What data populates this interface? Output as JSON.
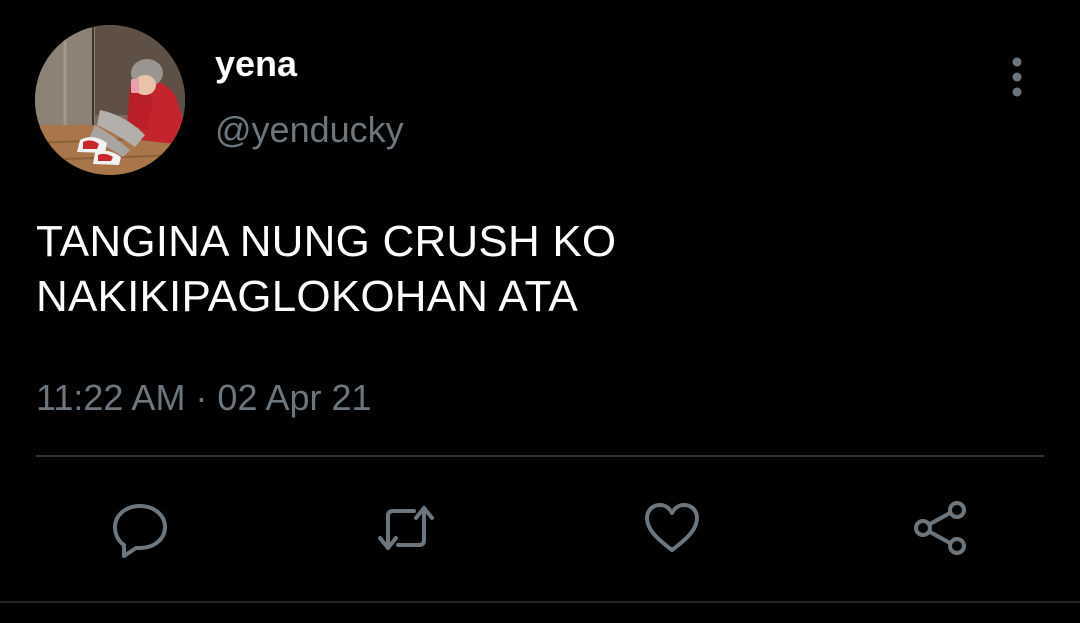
{
  "tweet": {
    "display_name": "yena",
    "handle": "@yenducky",
    "text_lines": [
      "TANGINA NUNG CRUSH KO",
      "NAKIKIPAGLOKOHAN ATA"
    ],
    "timestamp": "11:22 AM · 02 Apr 21"
  },
  "icons": {
    "more": "vertical-ellipsis",
    "reply": "speech-bubble",
    "retweet": "retweet-arrows",
    "like": "heart-outline",
    "share": "share-nodes"
  },
  "colors": {
    "background": "#000000",
    "primary_text": "#ffffff",
    "secondary_text": "#6e767d",
    "icon": "#6e767d",
    "divider": "#2f3336"
  }
}
